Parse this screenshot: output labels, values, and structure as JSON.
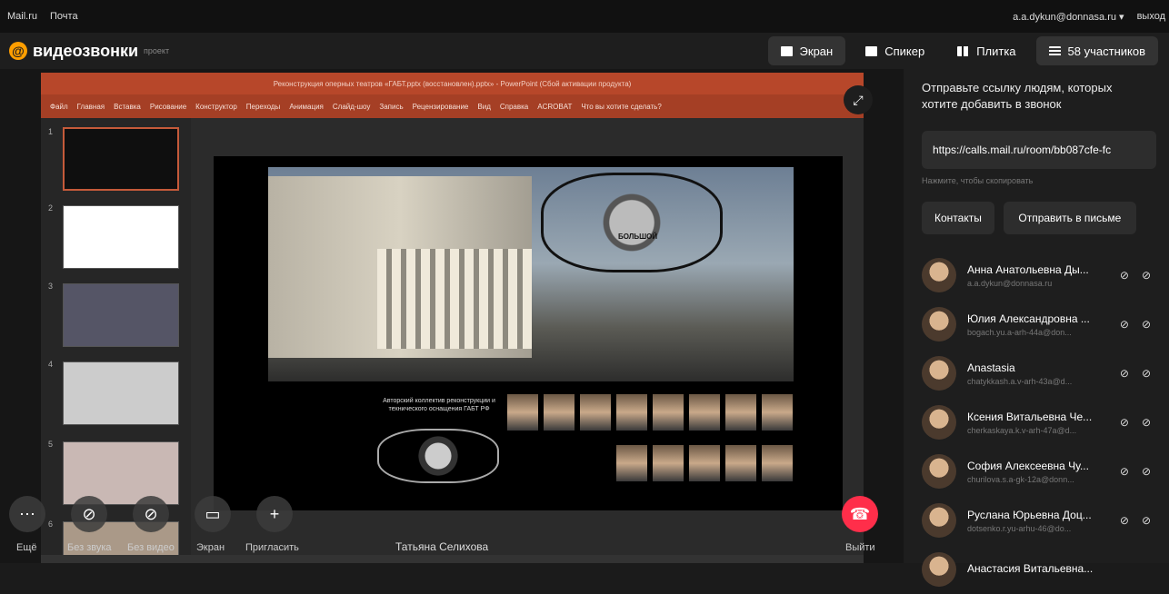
{
  "topbar": {
    "mailru": "Mail.ru",
    "pochta": "Почта",
    "email": "a.a.dykun@donnasa.ru ▾",
    "exit": "выход"
  },
  "header": {
    "logo": "видеозвонки",
    "project": "проект",
    "at": "@"
  },
  "view": {
    "screen": "Экран",
    "speaker": "Спикер",
    "tiles": "Плитка",
    "participants": "58 участников"
  },
  "ppt": {
    "title": "Реконструкция оперных театров «ГАБТ.pptx (восстановлен).pptx» - PowerPoint (Сбой активации продукта)",
    "ribbon": [
      "Файл",
      "Главная",
      "Вставка",
      "Рисование",
      "Конструктор",
      "Переходы",
      "Анимация",
      "Слайд-шоу",
      "Запись",
      "Рецензирование",
      "Вид",
      "Справка",
      "ACROBAT",
      "Что вы хотите сделать?"
    ],
    "thumb_nums": [
      "1",
      "2",
      "3",
      "4",
      "5",
      "6"
    ],
    "emblem_text": "БОЛЬШОЙ",
    "caption": "Авторский коллектив реконструкции и технического оснащения ГАБТ РФ"
  },
  "controls": {
    "more": "Ещё",
    "no_sound": "Без звука",
    "no_video": "Без видео",
    "screen": "Экран",
    "invite": "Пригласить",
    "exit": "Выйти",
    "speaker_name": "Татьяна Селихова"
  },
  "side": {
    "invite_text": "Отправьте ссылку людям, которых хотите добавить в звонок",
    "link": "https://calls.mail.ru/room/bb087cfe-fc",
    "copy_hint": "Нажмите, чтобы скопировать",
    "contacts": "Контакты",
    "send_mail": "Отправить в письме"
  },
  "participants": [
    {
      "name": "Анна Анатольевна Ды...",
      "email": "a.a.dykun@donnasa.ru"
    },
    {
      "name": "Юлия Александровна ...",
      "email": "bogach.yu.a-arh-44a@don..."
    },
    {
      "name": "Anastasia",
      "email": "chatykkash.a.v-arh-43a@d..."
    },
    {
      "name": "Ксения Витальевна Че...",
      "email": "cherkaskaya.k.v-arh-47a@d..."
    },
    {
      "name": "София Алексеевна Чу...",
      "email": "churilova.s.a-gk-12a@donn..."
    },
    {
      "name": "Руслана Юрьевна Доц...",
      "email": "dotsenko.r.yu-arhu-46@do..."
    },
    {
      "name": "Анастасия Витальевна...",
      "email": ""
    }
  ]
}
